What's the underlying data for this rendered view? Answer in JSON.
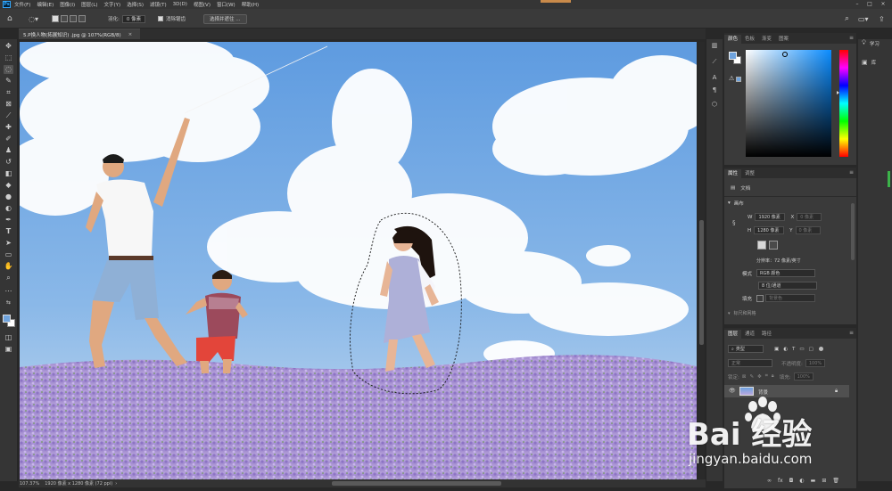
{
  "menubar": {
    "logo": "Ps",
    "items": [
      "文件(F)",
      "编辑(E)",
      "图像(I)",
      "图层(L)",
      "文字(Y)",
      "选择(S)",
      "滤镜(T)",
      "3D(D)",
      "视图(V)",
      "窗口(W)",
      "帮助(H)"
    ]
  },
  "options": {
    "feather_label": "羽化:",
    "feather_value": "0 像素",
    "antialias_label": "消除锯齿",
    "select_subject_button": "选择并遮住 ..."
  },
  "document": {
    "tab_title": "5.P换人物(拓展知识) .jpg @ 107%(RGB/8)",
    "close": "×"
  },
  "status": {
    "zoom": "107.37%",
    "doc_info": "1920 像素 x 1280 像素 (72 ppi)"
  },
  "color_panel": {
    "tabs": [
      "颜色",
      "色板",
      "渐变",
      "图案"
    ],
    "fg_color": "#6fa3dd",
    "bg_color": "#ffffff",
    "picker_hue": "#0a8cff"
  },
  "properties_panel": {
    "tabs": [
      "属性",
      "调整"
    ],
    "doc_label": "文档",
    "canvas_section": "画布",
    "w_label": "W",
    "w_value": "1920 像素",
    "x_label": "X",
    "x_value": "0 像素",
    "h_label": "H",
    "h_value": "1280 像素",
    "y_label": "Y",
    "y_value": "0 像素",
    "resolution": "分辨率：72 像素/英寸",
    "mode_label": "模式",
    "mode_value": "RGB 颜色",
    "depth_value": "8 位/通道",
    "fill_label": "填充",
    "fill_value": "背景色",
    "more_section": "标尺和网格"
  },
  "layers_panel": {
    "tabs": [
      "图层",
      "通道",
      "路径"
    ],
    "kind_filter": "类型",
    "blend_mode": "正常",
    "opacity_label": "不透明度:",
    "opacity_value": "100%",
    "lock_label": "锁定:",
    "fill_label": "填充:",
    "fill_value": "100%",
    "layer_name": "背景"
  },
  "learn_panel": {
    "learn_label": "学习",
    "libraries_label": "库"
  },
  "watermark": {
    "main": "Bai  经验",
    "url": "jingyan.baidu.com"
  }
}
